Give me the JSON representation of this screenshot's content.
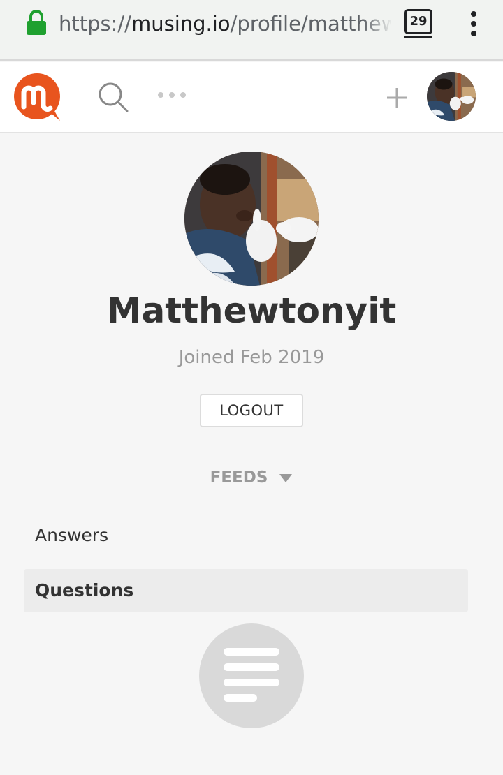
{
  "browser": {
    "url_scheme": "https://",
    "url_host": "musing.io",
    "url_path": "/profile/matthewtonyit",
    "tab_count": "29"
  },
  "header": {
    "logo_icon": "musing-logo",
    "brand_color": "#e8541e"
  },
  "profile": {
    "username": "Matthewtonyit",
    "joined": "Joined Feb 2019",
    "logout_label": "LOGOUT"
  },
  "feeds": {
    "label": "FEEDS",
    "items": [
      "Answers",
      "Questions"
    ],
    "selected": "Questions"
  },
  "empty_state": {
    "icon": "text-lines-icon"
  }
}
